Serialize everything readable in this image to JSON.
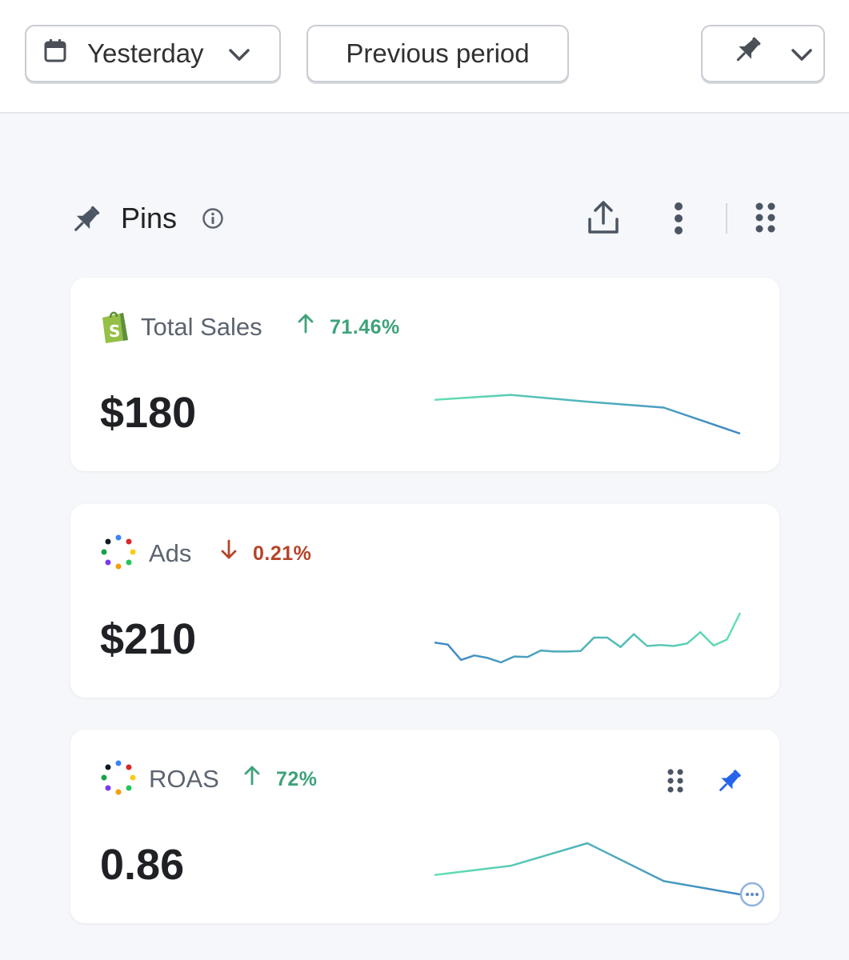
{
  "toolbar": {
    "date_range_label": "Yesterday",
    "compare_label": "Previous period",
    "date_icon": "calendar-icon",
    "dropdown_icon": "chevron-down-icon",
    "pin_icon": "pin-icon"
  },
  "section": {
    "title": "Pins",
    "icons": [
      "pin-icon",
      "info-icon",
      "share-icon",
      "kebab-icon",
      "drag-grid-icon"
    ]
  },
  "cards": [
    {
      "title": "Total Sales",
      "change": "71.46%",
      "direction": "up",
      "value": "$180",
      "source_icon": "shopify-icon",
      "sparkline": [
        0.74,
        0.85,
        0.7,
        0.57,
        0.0
      ]
    },
    {
      "title": "Ads",
      "change": "0.21%",
      "direction": "down",
      "value": "$210",
      "source_icon": "multi-dot-logo-icon",
      "sparkline": [
        0.4,
        0.36,
        0.05,
        0.14,
        0.09,
        0.0,
        0.12,
        0.11,
        0.24,
        0.22,
        0.22,
        0.23,
        0.5,
        0.5,
        0.31,
        0.57,
        0.33,
        0.35,
        0.33,
        0.38,
        0.61,
        0.34,
        0.46,
        1.0
      ]
    },
    {
      "title": "ROAS",
      "change": "72%",
      "direction": "up",
      "value": "0.86",
      "source_icon": "multi-dot-logo-icon",
      "sparkline": [
        0.38,
        0.56,
        1.0,
        0.26,
        0.0
      ]
    }
  ],
  "colors": {
    "up": "#3fa27a",
    "down": "#b5452a",
    "spark_start": "#62e0b0",
    "spark_end": "#3f86c4",
    "active_pin": "#2563eb"
  }
}
